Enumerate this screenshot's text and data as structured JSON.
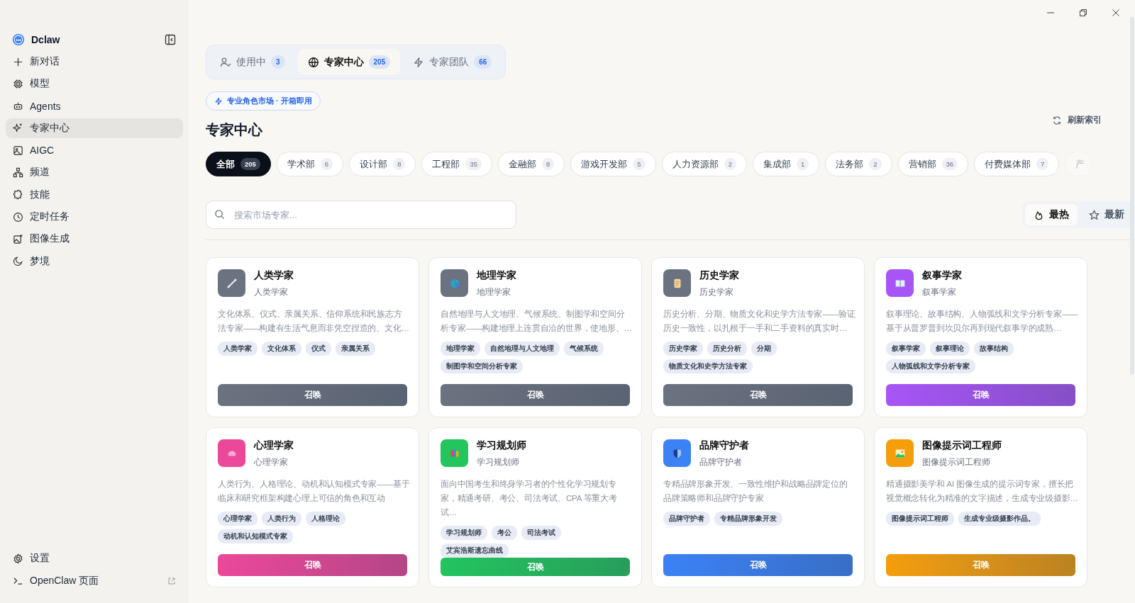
{
  "sidebar": {
    "brand": "Dclaw",
    "items": [
      {
        "label": "新对话",
        "selected": false
      },
      {
        "label": "模型",
        "selected": false
      },
      {
        "label": "Agents",
        "selected": false
      },
      {
        "label": "专家中心",
        "selected": true
      },
      {
        "label": "AIGC",
        "selected": false
      },
      {
        "label": "频道",
        "selected": false
      },
      {
        "label": "技能",
        "selected": false
      },
      {
        "label": "定时任务",
        "selected": false
      },
      {
        "label": "图像生成",
        "selected": false
      },
      {
        "label": "梦境",
        "selected": false
      }
    ],
    "footer": [
      {
        "label": "设置",
        "external": false
      },
      {
        "label": "OpenClaw 页面",
        "external": true
      }
    ]
  },
  "tabs": [
    {
      "label": "使用中",
      "count": "3",
      "selected": false
    },
    {
      "label": "专家中心",
      "count": "205",
      "selected": true
    },
    {
      "label": "专家团队",
      "count": "66",
      "selected": false
    }
  ],
  "badge": "专业角色市场 · 开箱即用",
  "title": "专家中心",
  "refresh": "刷新索引",
  "categories": [
    {
      "label": "全部",
      "count": "205",
      "selected": true,
      "faded": false
    },
    {
      "label": "学术部",
      "count": "6",
      "selected": false,
      "faded": false
    },
    {
      "label": "设计部",
      "count": "8",
      "selected": false,
      "faded": false
    },
    {
      "label": "工程部",
      "count": "35",
      "selected": false,
      "faded": false
    },
    {
      "label": "金融部",
      "count": "8",
      "selected": false,
      "faded": false
    },
    {
      "label": "游戏开发部",
      "count": "5",
      "selected": false,
      "faded": false
    },
    {
      "label": "人力资源部",
      "count": "2",
      "selected": false,
      "faded": false
    },
    {
      "label": "集成部",
      "count": "1",
      "selected": false,
      "faded": false
    },
    {
      "label": "法务部",
      "count": "2",
      "selected": false,
      "faded": false
    },
    {
      "label": "营销部",
      "count": "36",
      "selected": false,
      "faded": false
    },
    {
      "label": "付费媒体部",
      "count": "7",
      "selected": false,
      "faded": false
    },
    {
      "label": "产",
      "selected": false,
      "faded": true
    }
  ],
  "search": {
    "placeholder": "搜索市场专家..."
  },
  "sort": [
    {
      "label": "最热",
      "selected": true
    },
    {
      "label": "最新",
      "selected": false
    }
  ],
  "cards": [
    {
      "name": "人类学家",
      "subtitle": "人类学家",
      "description": "文化体系、仪式、亲属关系、信仰系统和民族志方法专家——构建有生活气息而非凭空捏造的、文化…",
      "tags": [
        "人类学家",
        "文化体系",
        "仪式",
        "亲属关系"
      ],
      "action": "召唤",
      "color": "#6b7280"
    },
    {
      "name": "地理学家",
      "subtitle": "地理学家",
      "description": "自然地理与人文地理、气候系统、制图学和空间分析专家——构建地理上连贯自洽的世界，使地形、…",
      "tags": [
        "地理学家",
        "自然地理与人文地理",
        "气候系统",
        "制图学和空间分析专家"
      ],
      "action": "召唤",
      "color": "#6b7280"
    },
    {
      "name": "历史学家",
      "subtitle": "历史学家",
      "description": "历史分析、分期、物质文化和史学方法专家——验证历史一致性，以扎根于一手和二手资料的真实时…",
      "tags": [
        "历史学家",
        "历史分析",
        "分期",
        "物质文化和史学方法专家"
      ],
      "action": "召唤",
      "color": "#6b7280"
    },
    {
      "name": "叙事学家",
      "subtitle": "叙事学家",
      "description": "叙事理论、故事结构、人物弧线和文学分析专家——基于从普罗普到坎贝尔再到现代叙事学的成熟…",
      "tags": [
        "叙事学家",
        "叙事理论",
        "故事结构",
        "人物弧线和文学分析专家"
      ],
      "action": "召唤",
      "color": "#a855f7"
    },
    {
      "name": "心理学家",
      "subtitle": "心理学家",
      "description": "人类行为、人格理论、动机和认知模式专家——基于临床和研究框架构建心理上可信的角色和互动",
      "tags": [
        "心理学家",
        "人类行为",
        "人格理论",
        "动机和认知模式专家"
      ],
      "action": "召唤",
      "color": "#ec4899"
    },
    {
      "name": "学习规划师",
      "subtitle": "学习规划师",
      "description": "面向中国考生和终身学习者的个性化学习规划专家，精通考研、考公、司法考试、CPA 等重大考试…",
      "tags": [
        "学习规划师",
        "考公",
        "司法考试",
        "艾宾浩斯遗忘曲线"
      ],
      "action": "召唤",
      "color": "#22c55e"
    },
    {
      "name": "品牌守护者",
      "subtitle": "品牌守护者",
      "description": "专精品牌形象开发、一致性维护和战略品牌定位的品牌策略师和品牌守护专家",
      "tags": [
        "品牌守护者",
        "专精品牌形象开发"
      ],
      "action": "召唤",
      "color": "#3b82f6"
    },
    {
      "name": "图像提示词工程师",
      "subtitle": "图像提示词工程师",
      "description": "精通摄影美学和 AI 图像生成的提示词专家，擅长把视觉概念转化为精准的文字描述，生成专业级摄影…",
      "tags": [
        "图像提示词工程师",
        "生成专业级摄影作品。"
      ],
      "action": "召唤",
      "color": "#f59e0b"
    }
  ]
}
